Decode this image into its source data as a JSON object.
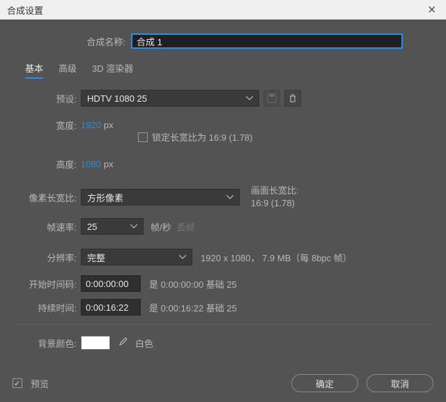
{
  "window": {
    "title": "合成设置"
  },
  "composition": {
    "name_label": "合成名称:",
    "name_value": "合成 1"
  },
  "tabs": {
    "basic": "基本",
    "advanced": "高级",
    "renderer": "3D 渲染器"
  },
  "preset": {
    "label": "预设:",
    "value": "HDTV 1080 25"
  },
  "width": {
    "label": "宽度:",
    "value": "1920",
    "unit": "px"
  },
  "height": {
    "label": "高度:",
    "value": "1080",
    "unit": "px"
  },
  "lock_aspect": {
    "label": "锁定长宽比为 16:9 (1.78)"
  },
  "par": {
    "label": "像素长宽比:",
    "value": "方形像素"
  },
  "far": {
    "label": "画面长宽比:",
    "value": "16:9 (1.78)"
  },
  "fps": {
    "label": "帧速率:",
    "value": "25",
    "unit": "帧/秒",
    "drop": "丢帧"
  },
  "resolution": {
    "label": "分辨率:",
    "value": "完整",
    "info": "1920 x 1080， 7.9 MB（每 8bpc 帧）"
  },
  "start": {
    "label": "开始时间码:",
    "value": "0:00:00:00",
    "info": "是 0:00:00:00 基础 25"
  },
  "duration": {
    "label": "持续时间:",
    "value": "0:00:16:22",
    "info": "是 0:00:16:22 基础 25"
  },
  "bgcolor": {
    "label": "背景颜色:",
    "name": "白色",
    "hex": "#ffffff"
  },
  "footer": {
    "preview": "预览",
    "ok": "确定",
    "cancel": "取消"
  }
}
